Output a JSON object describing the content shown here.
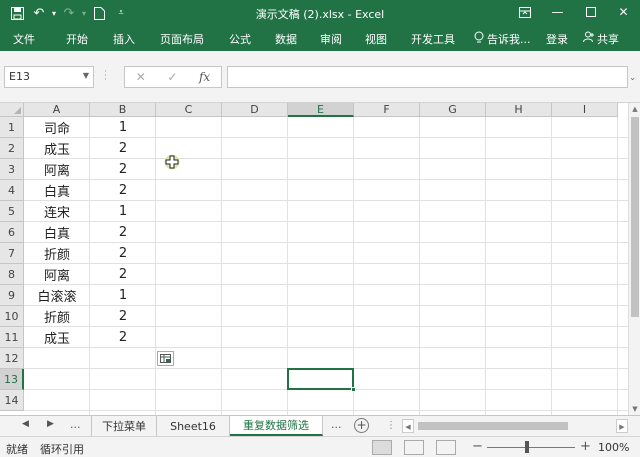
{
  "window": {
    "title": "演示文稿 (2).xlsx - Excel"
  },
  "ribbon_tabs": [
    "文件",
    "开始",
    "插入",
    "页面布局",
    "公式",
    "数据",
    "审阅",
    "视图",
    "开发工具"
  ],
  "tell_me": "告诉我...",
  "login": "登录",
  "share": "共享",
  "name_box": "E13",
  "formula_value": "",
  "columns": [
    "A",
    "B",
    "C",
    "D",
    "E",
    "F",
    "G",
    "H",
    "I"
  ],
  "selected_column": "E",
  "rows": [
    "1",
    "2",
    "3",
    "4",
    "5",
    "6",
    "7",
    "8",
    "9",
    "10",
    "11",
    "12",
    "13",
    "14"
  ],
  "selected_row": "13",
  "cells": {
    "A": [
      "司命",
      "成玉",
      "阿离",
      "白真",
      "连宋",
      "白真",
      "折颜",
      "阿离",
      "白滚滚",
      "折颜",
      "成玉"
    ],
    "B": [
      "1",
      "2",
      "2",
      "2",
      "1",
      "2",
      "2",
      "2",
      "1",
      "2",
      "2"
    ]
  },
  "sheet_tabs": {
    "nav_more": "...",
    "tabs": [
      "下拉菜单",
      "Sheet16",
      "重复数据筛选"
    ],
    "active": "重复数据筛选",
    "more": "..."
  },
  "status": {
    "ready": "就绪",
    "circular": "循环引用",
    "zoom": "100%"
  },
  "colors": {
    "accent": "#217346"
  }
}
